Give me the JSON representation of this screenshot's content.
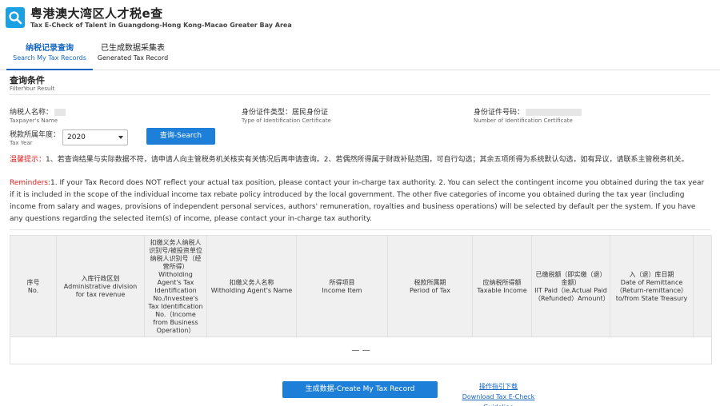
{
  "header": {
    "title_cn": "粤港澳大湾区人才税e查",
    "title_en": "Tax E-Check of Talent in Guangdong-Hong Kong-Macao Greater Bay Area",
    "logo_icon": "magnifier-icon"
  },
  "tabs": [
    {
      "cn": "纳税记录查询",
      "en": "Search My Tax Records",
      "active": true
    },
    {
      "cn": "已生成数据采集表",
      "en": "Generated Tax Record",
      "active": false
    }
  ],
  "query": {
    "title_cn": "查询条件",
    "title_en": "FilterYour Result",
    "taxpayer_name": {
      "cn": "纳税人名称：",
      "en": "Taxpayer's Name"
    },
    "id_type": {
      "cn": "身份证件类型：居民身份证",
      "en": "Type of Identification Certificate"
    },
    "id_number": {
      "cn": "身份证件号码：",
      "en": "Number of Identification Certificate"
    },
    "tax_year": {
      "cn": "税款所属年度：",
      "en": "Tax Year",
      "value": "2020"
    },
    "search_button": "查询-Search"
  },
  "reminders": {
    "label_cn": "温馨提示：",
    "text_cn": "1、若查询结果与实际数据不符，请申请人向主管税务机关核实有关情况后再申请查询。2、若偶然所得属于财政补贴范围，可自行勾选；其余五项所得为系统默认勾选，如有异议，请联系主管税务机关。",
    "label_en": "Reminders:",
    "text_en": "1. If your Tax Record does NOT reflect your actual tax position, please contact your in-charge tax authority. 2. You can select the contingent income you obtained during the tax year if it is included in the scope of the individual income tax rebate policy introduced by the local government. The other five categories of income you obtained during the tax year (including income from salary and wages, provisions of independent personal services, authors' remuneration, royalties and business operations) will be selected by default per the system. If you have any questions regarding the selected item(s) of income, please contact your in-charge tax authority."
  },
  "table": {
    "columns": [
      {
        "cn": "序号",
        "en": "No."
      },
      {
        "cn": "入库行政区划",
        "en": "Administrative division for tax revenue"
      },
      {
        "cn": "扣缴义务人纳税人识别号/被投资单位纳税人识别号（经营所得）",
        "en": "Witholding Agent's Tax Identification No./Investee's Tax Identification No.（Income from Business Operation）"
      },
      {
        "cn": "扣缴义务人名称",
        "en": "Witholding Agent's Name"
      },
      {
        "cn": "所得项目",
        "en": "Income Item"
      },
      {
        "cn": "税款所属期",
        "en": "Period of Tax"
      },
      {
        "cn": "应纳税所得额",
        "en": "Taxable Income"
      },
      {
        "cn": "已缴税额（即实缴（退）金额）",
        "en": "IIT Paid（ie.Actual Paid（Refunded）Amount）"
      },
      {
        "cn": "入（退）库日期",
        "en": "Date of Remittance（Return-remittance）to/from State Treasury"
      }
    ],
    "empty_text": "— —"
  },
  "footer": {
    "create_button": "生成数据-Create My Tax Record",
    "guide_cn": "操作指引下载",
    "guide_en": "Download Tax E-Check Guideline"
  }
}
